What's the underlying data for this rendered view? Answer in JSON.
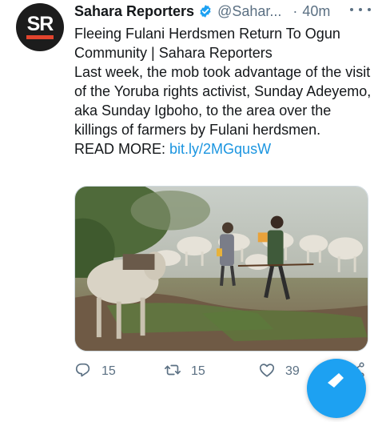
{
  "tweet": {
    "avatar_text": "SR",
    "author_name": "Sahara Reporters",
    "handle": "@Sahar...",
    "separator": "·",
    "time": "40m",
    "headline": "Fleeing Fulani Herdsmen Return To Ogun Community | Sahara Reporters",
    "body": "Last week, the mob took advantage of the visit of the Yoruba rights activist, Sunday Adeyemo, aka Sunday Igboho, to the area over the killings of farmers by Fulani herdsmen.",
    "read_more_label": "READ MORE:",
    "link_text": "bit.ly/2MGqusW"
  },
  "actions": {
    "reply_count": "15",
    "retweet_count": "15",
    "like_count": "39"
  },
  "icons": {
    "verified": "verified-badge-icon",
    "more": "more-options-icon",
    "reply": "reply-icon",
    "retweet": "retweet-icon",
    "like": "heart-icon",
    "share": "share-icon",
    "compose": "compose-fab"
  },
  "colors": {
    "accent": "#1da1f2",
    "link": "#1b95e0",
    "secondary_text": "#5b7083",
    "avatar_bg": "#1c1c1c",
    "avatar_bar": "#e2442d"
  }
}
